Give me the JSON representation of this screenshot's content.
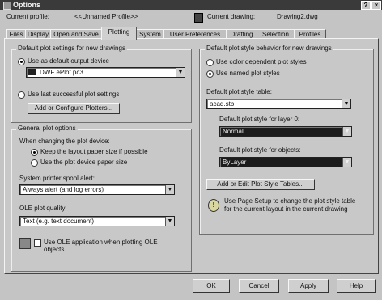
{
  "window": {
    "title": "Options"
  },
  "header": {
    "current_profile_label": "Current profile:",
    "current_profile_value": "<<Unnamed Profile>>",
    "current_drawing_label": "Current drawing:",
    "current_drawing_value": "Drawing2.dwg"
  },
  "tabs": [
    {
      "label": "Files"
    },
    {
      "label": "Display"
    },
    {
      "label": "Open and Save"
    },
    {
      "label": "Plotting",
      "active": true
    },
    {
      "label": "System"
    },
    {
      "label": "User Preferences"
    },
    {
      "label": "Drafting"
    },
    {
      "label": "Selection"
    },
    {
      "label": "Profiles"
    }
  ],
  "default_plot_settings": {
    "title": "Default plot settings for new drawings",
    "use_default_device_label": "Use as default output device",
    "device_value": "DWF ePlot.pc3",
    "use_last_successful_label": "Use last successful plot settings",
    "add_configure_button": "Add or Configure Plotters..."
  },
  "general_plot_options": {
    "title": "General plot options",
    "when_changing_label": "When changing the plot device:",
    "keep_layout_label": "Keep the layout paper size if possible",
    "use_device_size_label": "Use the plot device paper size",
    "spool_alert_label": "System printer spool alert:",
    "spool_alert_value": "Always alert (and log errors)",
    "ole_quality_label": "OLE plot quality:",
    "ole_quality_value": "Text (e.g. text document)",
    "use_ole_app_label": "Use OLE application when plotting OLE",
    "use_ole_app_label2": "objects"
  },
  "plot_style_behavior": {
    "title": "Default plot style behavior for new drawings",
    "use_color_dependent_label": "Use color dependent plot styles",
    "use_named_label": "Use named plot styles",
    "default_table_label": "Default plot style table:",
    "default_table_value": "acad.stb",
    "layer0_label": "Default plot style for layer 0:",
    "layer0_value": "Normal",
    "objects_label": "Default plot style for objects:",
    "objects_value": "ByLayer",
    "add_edit_button": "Add or Edit Plot Style Tables...",
    "info_text_1": "Use Page Setup to change the plot style table",
    "info_text_2": "for the current layout in the current drawing"
  },
  "footer": {
    "ok": "OK",
    "cancel": "Cancel",
    "apply": "Apply",
    "help": "Help"
  }
}
